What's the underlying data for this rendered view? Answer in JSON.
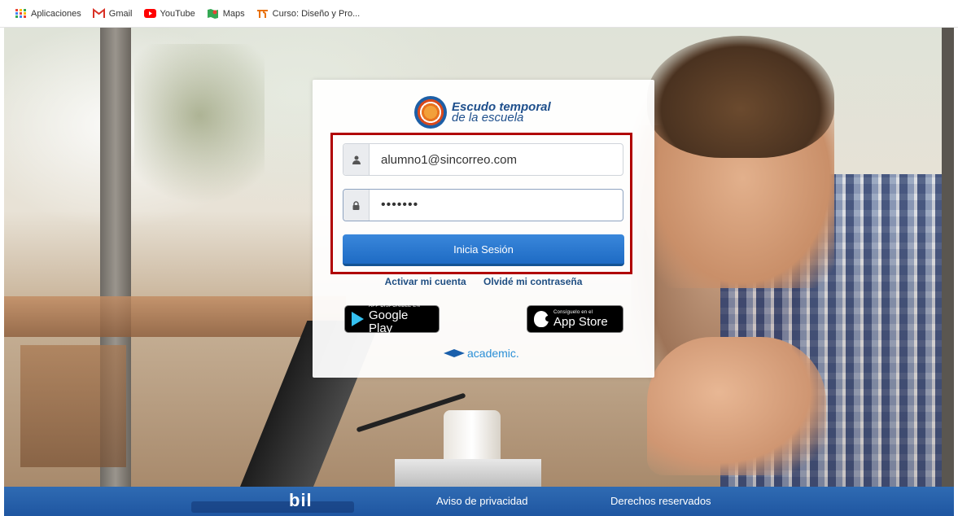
{
  "bookmarks": [
    {
      "label": "Aplicaciones",
      "icon": "apps-grid-icon"
    },
    {
      "label": "Gmail",
      "icon": "gmail-icon"
    },
    {
      "label": "YouTube",
      "icon": "youtube-icon"
    },
    {
      "label": "Maps",
      "icon": "maps-icon"
    },
    {
      "label": "Curso: Diseño y Pro...",
      "icon": "course-icon"
    }
  ],
  "logo": {
    "line1": "Escudo temporal",
    "line2": "de la escuela"
  },
  "login": {
    "email_value": "alumno1@sincorreo.com",
    "password_value": "•••••••",
    "submit_label": "Inicia Sesión"
  },
  "links": {
    "activate": "Activar mi cuenta",
    "forgot": "Olvidé mi contraseña"
  },
  "stores": {
    "google_small": "APP DISPONIBLE EN",
    "google_big": "Google Play",
    "apple_small": "Consíguelo en el",
    "apple_big": "App Store"
  },
  "powered_by": "academic.",
  "footer": {
    "brand": "bil",
    "privacy": "Aviso de privacidad",
    "rights": "Derechos reservados"
  },
  "colors": {
    "primary": "#1e6bc4",
    "highlight": "#b00000",
    "footer": "#2a62ad",
    "link": "#1f4e82"
  }
}
